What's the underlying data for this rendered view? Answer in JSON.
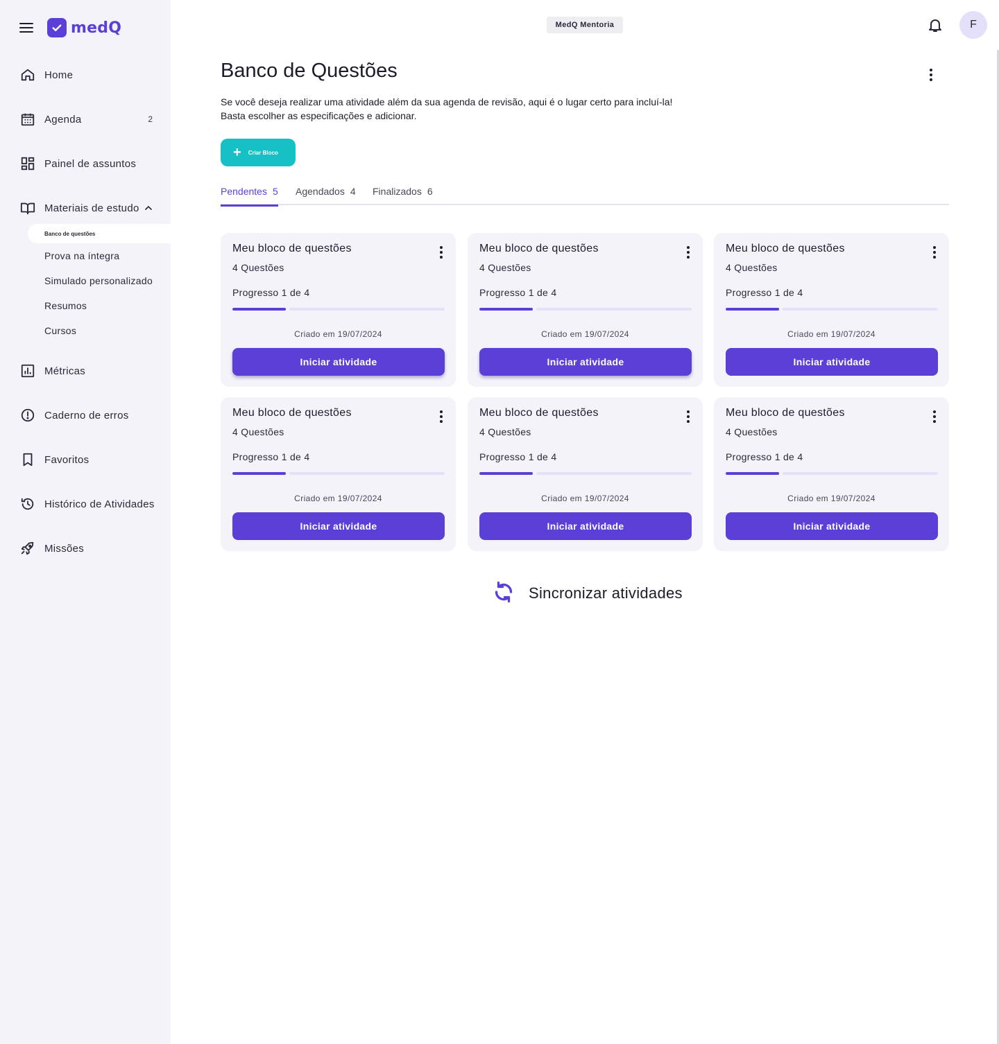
{
  "brand": {
    "name": "medQ",
    "color": "#5b3fd6"
  },
  "sidebar": {
    "items": [
      {
        "label": "Home",
        "icon": "home-icon"
      },
      {
        "label": "Agenda",
        "icon": "calendar-icon",
        "badge": "2"
      },
      {
        "label": "Painel de assuntos",
        "icon": "dashboard-icon"
      },
      {
        "label": "Materiais de estudo",
        "icon": "book-icon",
        "expanded": true
      },
      {
        "label": "Métricas",
        "icon": "bar-chart-icon"
      },
      {
        "label": "Caderno de erros",
        "icon": "alert-circle-icon"
      },
      {
        "label": "Favoritos",
        "icon": "bookmark-icon"
      },
      {
        "label": "Histórico de Atividades",
        "icon": "history-icon"
      },
      {
        "label": "Missões",
        "icon": "rocket-icon"
      }
    ],
    "sub_items": [
      {
        "label": "Banco de questões",
        "active": true
      },
      {
        "label": "Prova na íntegra"
      },
      {
        "label": "Simulado personalizado"
      },
      {
        "label": "Resumos"
      },
      {
        "label": "Cursos"
      }
    ]
  },
  "topbar": {
    "chip": "MedQ Mentoria",
    "avatar_initial": "F"
  },
  "main": {
    "title": "Banco de Questões",
    "description_line1": "Se você deseja realizar uma atividade além da sua agenda de revisão, aqui é o lugar certo para incluí-la!",
    "description_line2": "Basta escolher as especificações e adicionar.",
    "create_button": "Criar Bloco",
    "accent_teal": "#15c1c4",
    "tabs": [
      {
        "label": "Pendentes",
        "count": "5",
        "active": true
      },
      {
        "label": "Agendados",
        "count": "4"
      },
      {
        "label": "Finalizados",
        "count": "6"
      }
    ],
    "cards": [
      {
        "title": "Meu bloco de questões",
        "count": "4 Questões",
        "progress": "Progresso 1 de 4",
        "progress_value": 0.25,
        "created": "Criado em 19/07/2024",
        "button": "Iniciar atividade"
      },
      {
        "title": "Meu bloco de questões",
        "count": "4 Questões",
        "progress": "Progresso 1 de 4",
        "progress_value": 0.25,
        "created": "Criado em 19/07/2024",
        "button": "Iniciar atividade"
      },
      {
        "title": "Meu bloco de questões",
        "count": "4 Questões",
        "progress": "Progresso 1 de 4",
        "progress_value": 0.25,
        "created": "Criado em 19/07/2024",
        "button": "Iniciar atividade"
      },
      {
        "title": "Meu bloco de questões",
        "count": "4 Questões",
        "progress": "Progresso 1 de 4",
        "progress_value": 0.25,
        "created": "Criado em 19/07/2024",
        "button": "Iniciar atividade"
      },
      {
        "title": "Meu bloco de questões",
        "count": "4 Questões",
        "progress": "Progresso 1 de 4",
        "progress_value": 0.25,
        "created": "Criado em 19/07/2024",
        "button": "Iniciar atividade"
      },
      {
        "title": "Meu bloco de questões",
        "count": "4 Questões",
        "progress": "Progresso 1 de 4",
        "progress_value": 0.25,
        "created": "Criado em 19/07/2024",
        "button": "Iniciar atividade"
      }
    ],
    "sync_label": "Sincronizar atividades"
  }
}
